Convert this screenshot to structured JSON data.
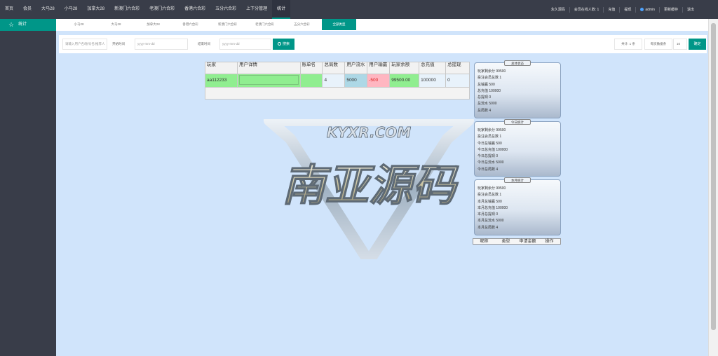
{
  "topnav": {
    "items": [
      "首页",
      "会员",
      "大马28",
      "小马28",
      "加拿大28",
      "新澳门六合彩",
      "老澳门六合彩",
      "香港六合彩",
      "五分六合彩",
      "上下分管理",
      "统计"
    ],
    "active_index": 10
  },
  "topright": {
    "items": [
      "永久源码",
      "会员在线人数: 1",
      "充值",
      "提现",
      "admin",
      "更新缓存",
      "退出"
    ]
  },
  "sidebar": {
    "item_label": "统计"
  },
  "tabs": {
    "items": [
      "小马28",
      "大马28",
      "加拿大28",
      "香港六合彩",
      "新澳门六合彩",
      "老澳门六合彩",
      "五分六合彩",
      "全部类型"
    ],
    "active_index": 7
  },
  "filter": {
    "account_placeholder": "请输入用户名/账号名/推荐人",
    "start_label": "开始时间",
    "start_placeholder": "yyyy-mm-dd",
    "end_label": "结束时间",
    "end_placeholder": "yyyy-mm-dd",
    "search_label": "搜索",
    "total_label": "共计: 1 条",
    "per_page_label": "每页数据条",
    "per_page_value": "10",
    "ok_label": "确定"
  },
  "table": {
    "headers": [
      "玩家",
      "用户详情",
      "账单名",
      "总局数",
      "用户流水",
      "用户输赢",
      "玩家余额",
      "总充值",
      "总提现"
    ],
    "row": {
      "player": "aa112233",
      "detail": "",
      "bill": "",
      "rounds": "4",
      "flow": "5000",
      "win_loss": "-500",
      "balance": "99500.00",
      "recharge": "100000",
      "withdraw": "0"
    }
  },
  "watermark": {
    "top": "KYXR.COM",
    "main": "南亚源码"
  },
  "cards": [
    {
      "title": "总体状态",
      "lines": [
        "玩家剩余分 99500",
        "投注会员总数 1",
        "总输赢 500",
        "总充值 100000",
        "总提现 0",
        "总流水 5000",
        "总局数 4"
      ]
    },
    {
      "title": "今日统计",
      "lines": [
        "玩家剩余分 99500",
        "投注会员总数 1",
        "今日总输赢 500",
        "今日总充值 100000",
        "今日总提现 0",
        "今日总流水 5000",
        "今日总局数 4"
      ]
    },
    {
      "title": "本月统计",
      "lines": [
        "玩家剩余分 99500",
        "投注会员总数 1",
        "本月总输赢 500",
        "本月总充值 100000",
        "本月总提现 0",
        "本月总流水 5000",
        "本月总局数 4"
      ]
    }
  ],
  "mini_table": {
    "headers": [
      "昵称",
      "类型",
      "申请金额",
      "操作"
    ]
  },
  "colors": {
    "accent": "#009688",
    "nav_bg": "#393d49",
    "main_bg": "#d0e4fb",
    "cell_green": "#90ee90",
    "cell_blue": "#add8e6",
    "cell_pink": "#ffb6c1"
  }
}
